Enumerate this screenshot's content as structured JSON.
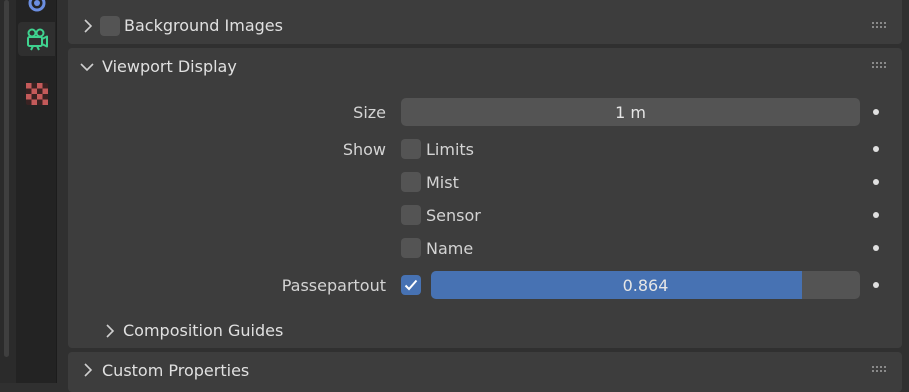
{
  "tabs": [
    {
      "icon": "object-constraint-icon",
      "active": false
    },
    {
      "icon": "camera-data-icon",
      "active": true
    },
    {
      "icon": "texture-checker-icon",
      "active": false
    }
  ],
  "panels": {
    "background_images": {
      "title": "Background Images",
      "enabled": false,
      "expanded": false
    },
    "viewport_display": {
      "title": "Viewport Display",
      "expanded": true,
      "size_label": "Size",
      "size_value": "1 m",
      "show_label": "Show",
      "show_items": [
        {
          "label": "Limits",
          "checked": false
        },
        {
          "label": "Mist",
          "checked": false
        },
        {
          "label": "Sensor",
          "checked": false
        },
        {
          "label": "Name",
          "checked": false
        }
      ],
      "passepartout_label": "Passepartout",
      "passepartout_enabled": true,
      "passepartout_value": "0.864",
      "passepartout_fraction": 0.864,
      "composition_guides": {
        "title": "Composition Guides",
        "expanded": false
      }
    },
    "custom_properties": {
      "title": "Custom Properties",
      "expanded": false
    }
  },
  "colors": {
    "accent": "#4772b3",
    "active_tab_icon": "#3fd28f",
    "checker_icon": "#c45a5a"
  }
}
